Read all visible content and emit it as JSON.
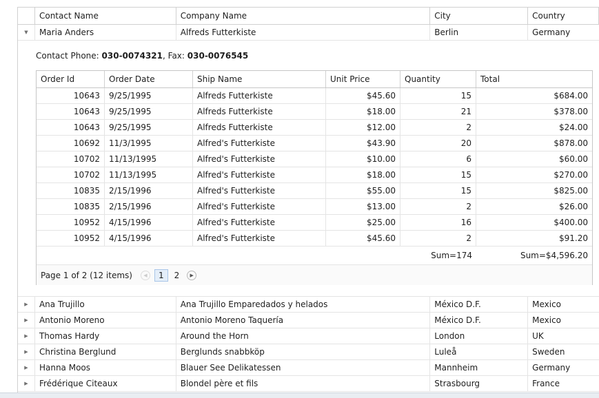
{
  "columns": [
    "Contact Name",
    "Company Name",
    "City",
    "Country"
  ],
  "expanded_row": {
    "contact": "Maria Anders",
    "company": "Alfreds Futterkiste",
    "city": "Berlin",
    "country": "Germany",
    "expander_glyph": "▼"
  },
  "detail": {
    "phone_label": "Contact Phone: ",
    "phone": "030-0074321",
    "fax_label": ", Fax: ",
    "fax": "030-0076545",
    "columns": [
      "Order Id",
      "Order Date",
      "Ship Name",
      "Unit Price",
      "Quantity",
      "Total"
    ],
    "orders": [
      {
        "id": "10643",
        "date": "9/25/1995",
        "ship": "Alfreds Futterkiste",
        "price": "$45.60",
        "qty": "15",
        "total": "$684.00"
      },
      {
        "id": "10643",
        "date": "9/25/1995",
        "ship": "Alfreds Futterkiste",
        "price": "$18.00",
        "qty": "21",
        "total": "$378.00"
      },
      {
        "id": "10643",
        "date": "9/25/1995",
        "ship": "Alfreds Futterkiste",
        "price": "$12.00",
        "qty": "2",
        "total": "$24.00"
      },
      {
        "id": "10692",
        "date": "11/3/1995",
        "ship": "Alfred's Futterkiste",
        "price": "$43.90",
        "qty": "20",
        "total": "$878.00"
      },
      {
        "id": "10702",
        "date": "11/13/1995",
        "ship": "Alfred's Futterkiste",
        "price": "$10.00",
        "qty": "6",
        "total": "$60.00"
      },
      {
        "id": "10702",
        "date": "11/13/1995",
        "ship": "Alfred's Futterkiste",
        "price": "$18.00",
        "qty": "15",
        "total": "$270.00"
      },
      {
        "id": "10835",
        "date": "2/15/1996",
        "ship": "Alfred's Futterkiste",
        "price": "$55.00",
        "qty": "15",
        "total": "$825.00"
      },
      {
        "id": "10835",
        "date": "2/15/1996",
        "ship": "Alfred's Futterkiste",
        "price": "$13.00",
        "qty": "2",
        "total": "$26.00"
      },
      {
        "id": "10952",
        "date": "4/15/1996",
        "ship": "Alfred's Futterkiste",
        "price": "$25.00",
        "qty": "16",
        "total": "$400.00"
      },
      {
        "id": "10952",
        "date": "4/15/1996",
        "ship": "Alfred's Futterkiste",
        "price": "$45.60",
        "qty": "2",
        "total": "$91.20"
      }
    ],
    "sum_qty": "Sum=174",
    "sum_total": "Sum=$4,596.20",
    "pager": {
      "info": "Page 1 of 2 (12 items)",
      "prev_glyph": "◀",
      "next_glyph": "▶",
      "pages": [
        "1",
        "2"
      ]
    }
  },
  "rows": [
    {
      "contact": "Ana Trujillo",
      "company": "Ana Trujillo Emparedados y helados",
      "city": "México D.F.",
      "country": "Mexico"
    },
    {
      "contact": "Antonio Moreno",
      "company": "Antonio Moreno Taquería",
      "city": "México D.F.",
      "country": "Mexico"
    },
    {
      "contact": "Thomas Hardy",
      "company": "Around the Horn",
      "city": "London",
      "country": "UK"
    },
    {
      "contact": "Christina Berglund",
      "company": "Berglunds snabbköp",
      "city": "Luleå",
      "country": "Sweden"
    },
    {
      "contact": "Hanna Moos",
      "company": "Blauer See Delikatessen",
      "city": "Mannheim",
      "country": "Germany"
    },
    {
      "contact": "Frédérique Citeaux",
      "company": "Blondel père et fils",
      "city": "Strasbourg",
      "country": "France"
    }
  ],
  "collapsed_glyph": "▶"
}
